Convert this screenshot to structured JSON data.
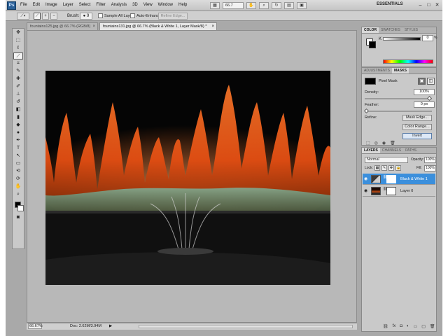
{
  "app": {
    "logo": "Ps",
    "workspace": "ESSENTIALS"
  },
  "menu": [
    "File",
    "Edit",
    "Image",
    "Layer",
    "Select",
    "Filter",
    "Analysis",
    "3D",
    "View",
    "Window",
    "Help"
  ],
  "menubar": {
    "zoom": "66.7"
  },
  "window_controls": {
    "minimize": "–",
    "maximize": "□",
    "close": "✕"
  },
  "options": {
    "brush_label": "Brush:",
    "brush_size": "9",
    "sample_all_layers": "Sample All Layers",
    "auto_enhance": "Auto-Enhance",
    "refine_edge": "Refine Edge..."
  },
  "documents": {
    "inactive_tab": "fountains125.jpg @ 66.7% (RGB/8)",
    "active_tab": "fountains131.jpg @ 66.7% (Black & White 1, Layer Mask/8) *",
    "close": "×"
  },
  "status": {
    "zoom": "66.67%",
    "doc": "Doc: 2.62M/3.94M",
    "arrow": "▶"
  },
  "color_panel": {
    "tabs": [
      "COLOR",
      "SWATCHES",
      "STYLES"
    ],
    "channel": "K",
    "value": "0",
    "unit": "%"
  },
  "adjustments_panel": {
    "tabs": [
      "ADJUSTMENTS",
      "MASKS"
    ],
    "mask_type": "Pixel Mask",
    "density_label": "Density:",
    "density_value": "100%",
    "density": 1.0,
    "feather_label": "Feather:",
    "feather_value": "0 px",
    "feather": 0.0,
    "refine_label": "Refine:",
    "mask_edge": "Mask Edge...",
    "color_range": "Color Range...",
    "invert": "Invert"
  },
  "layers_panel": {
    "tabs": [
      "LAYERS",
      "CHANNELS",
      "PATHS"
    ],
    "blend_mode": "Normal",
    "opacity_label": "Opacity:",
    "opacity": "100%",
    "lock_label": "Lock:",
    "fill_label": "Fill:",
    "fill": "100%",
    "layers": [
      {
        "name": "Black & White 1",
        "selected": true
      },
      {
        "name": "Layer 0",
        "selected": false
      }
    ]
  },
  "colors": {
    "accent_selected": "#3b8fdc",
    "fountain_orange": "#ff6a1a"
  }
}
